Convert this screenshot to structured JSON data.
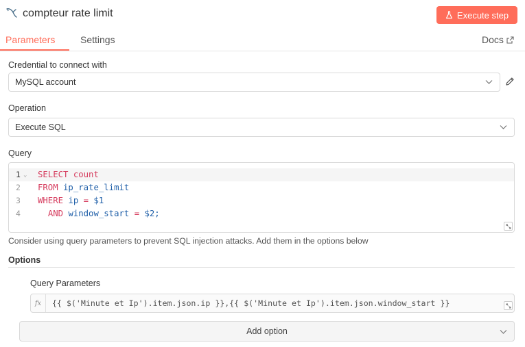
{
  "header": {
    "title": "compteur rate limit",
    "execute_label": "Execute step"
  },
  "tabs": {
    "parameters": "Parameters",
    "settings": "Settings",
    "docs": "Docs"
  },
  "credential": {
    "label": "Credential to connect with",
    "value": "MySQL account"
  },
  "operation": {
    "label": "Operation",
    "value": "Execute SQL"
  },
  "query": {
    "label": "Query",
    "lines": [
      {
        "n": "1",
        "tokens": [
          "SELECT",
          "count"
        ]
      },
      {
        "n": "2",
        "tokens": [
          "FROM",
          "ip_rate_limit"
        ]
      },
      {
        "n": "3",
        "tokens": [
          "WHERE",
          "ip",
          "=",
          "$1"
        ]
      },
      {
        "n": "4",
        "tokens": [
          "AND",
          "window_start",
          "=",
          "$2;"
        ]
      }
    ],
    "hint": "Consider using query parameters to prevent SQL injection attacks. Add them in the options below"
  },
  "options": {
    "title": "Options",
    "query_params_label": "Query Parameters",
    "fx": "fx",
    "query_params_value": "{{ $('Minute et Ip').item.json.ip }},{{ $('Minute et Ip').item.json.window_start }}",
    "add_option_label": "Add option"
  },
  "colors": {
    "accent": "#ff6d5a",
    "keyword": "#d63c5e",
    "identifier": "#1f5fa8"
  }
}
